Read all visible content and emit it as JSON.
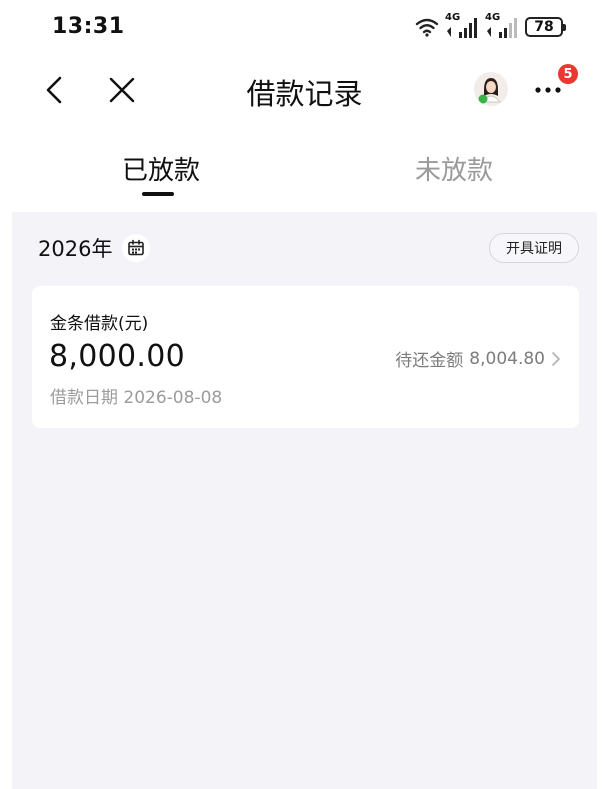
{
  "status_bar": {
    "time": "13:31",
    "battery": "78",
    "signal_label_1": "4G",
    "signal_label_2": "4G"
  },
  "nav": {
    "title": "借款记录",
    "more_badge": "5"
  },
  "tabs": [
    {
      "label": "已放款",
      "active": true
    },
    {
      "label": "未放款",
      "active": false
    }
  ],
  "filter": {
    "year_label": "2026年",
    "certificate_button": "开具证明"
  },
  "loans": [
    {
      "product": "金条借款(元)",
      "amount": "8,000.00",
      "pending_label": "待还金额",
      "pending_amount": "8,004.80",
      "date_label": "借款日期",
      "date": "2026-08-08"
    }
  ],
  "icons": {
    "back": "chevron-left-icon",
    "close": "close-icon",
    "more": "more-dots-icon",
    "calendar": "calendar-icon",
    "wifi": "wifi-icon",
    "signal": "signal-icon",
    "chevron": "chevron-right-icon"
  },
  "colors": {
    "badge": "#e8382f",
    "background_content": "#f3f3f8",
    "inactive_tab": "#9a9a9a"
  }
}
